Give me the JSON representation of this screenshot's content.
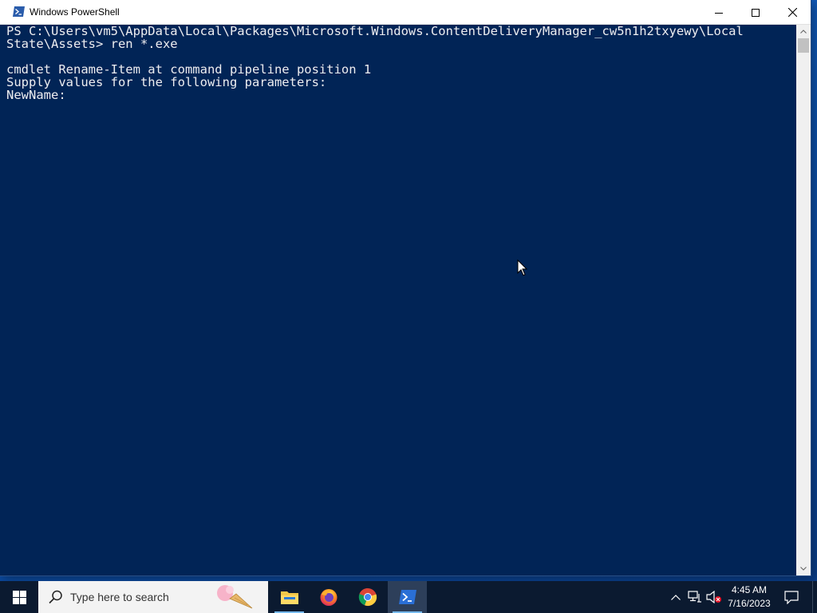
{
  "window": {
    "title": "Windows PowerShell"
  },
  "console": {
    "lines": [
      "PS C:\\Users\\vm5\\AppData\\Local\\Packages\\Microsoft.Windows.ContentDeliveryManager_cw5n1h2txyewy\\Local",
      "State\\Assets> ren *.exe",
      "",
      "cmdlet Rename-Item at command pipeline position 1",
      "Supply values for the following parameters:",
      "NewName:"
    ]
  },
  "taskbar": {
    "search_placeholder": "Type here to search",
    "apps": [
      {
        "name": "File Explorer",
        "icon": "folder-icon"
      },
      {
        "name": "Firefox",
        "icon": "firefox-icon"
      },
      {
        "name": "Chrome",
        "icon": "chrome-icon"
      },
      {
        "name": "Windows PowerShell",
        "icon": "powershell-icon",
        "active": true
      }
    ],
    "tray": {
      "time": "4:45 AM",
      "date": "7/16/2023"
    }
  },
  "colors": {
    "console_background": "#012456",
    "console_text": "#eeedf0",
    "taskbar_background": "#0b1a30",
    "active_app_underline": "#76b9ed"
  }
}
